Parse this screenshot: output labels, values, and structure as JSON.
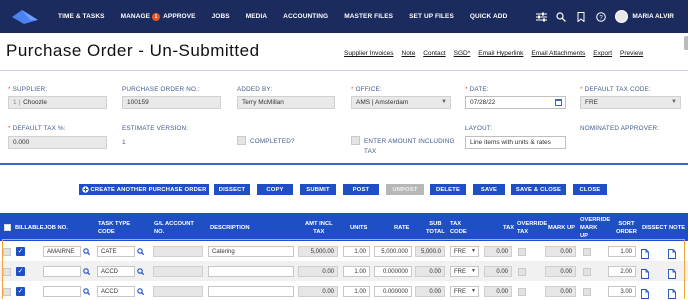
{
  "nav": {
    "items": [
      "TIME & TASKS",
      "MANAGE",
      "APPROVE",
      "JOBS",
      "MEDIA",
      "ACCOUNTING",
      "MASTER FILES",
      "SET UP FILES",
      "QUICK ADD"
    ],
    "approve_badge": "1",
    "user_name": "MARIA ALVIR"
  },
  "page": {
    "title": "Purchase Order - Un-Submitted",
    "action_links": [
      "Supplier Invoices",
      "Note",
      "Contact",
      "SGD*",
      "Email Hyperlink",
      "Email Attachments",
      "Export",
      "Preview"
    ]
  },
  "form": {
    "supplier": {
      "label": "SUPPLIER:",
      "prefix": "1 |",
      "value": "Choozle"
    },
    "po_number": {
      "label": "PURCHASE ORDER NO.:",
      "value": "100159"
    },
    "added_by": {
      "label": "ADDED BY:",
      "value": "Terry McMillan"
    },
    "office": {
      "label": "OFFICE:",
      "value": "AMS | Amsterdam"
    },
    "date": {
      "label": "DATE:",
      "value": "07/28/22"
    },
    "default_tax_code": {
      "label": "DEFAULT TAX CODE:",
      "value": "FRE"
    },
    "default_tax_pct": {
      "label": "DEFAULT TAX %:",
      "value": "0.000"
    },
    "estimate_version": {
      "label": "ESTIMATE VERSION:",
      "value": "1"
    },
    "completed": {
      "label": "COMPLETED?"
    },
    "enter_amount": {
      "label_line1": "ENTER AMOUNT INCLUDING",
      "label_line2": "TAX"
    },
    "layout": {
      "label": "LAYOUT:",
      "value": "Line items with units & rates"
    },
    "nominated_approver": {
      "label": "NOMINATED APPROVER:"
    }
  },
  "buttons": {
    "create_another": "CREATE ANOTHER PURCHASE ORDER",
    "dissect": "DISSECT",
    "copy": "COPY",
    "submit": "SUBMIT",
    "post": "POST",
    "unpost": "UNPOST",
    "delete": "DELETE",
    "save": "SAVE",
    "save_close": "SAVE & CLOSE",
    "close": "CLOSE"
  },
  "table": {
    "headers": {
      "billable": "BILLABLE",
      "job_no": "JOB NO.",
      "task_type_1": "TASK TYPE",
      "task_type_2": "CODE",
      "gl_1": "G/L ACCOUNT",
      "gl_2": "NO.",
      "description": "DESCRIPTION",
      "amt_1": "AMT INCL",
      "amt_2": "TAX",
      "units": "UNITS",
      "rate": "RATE",
      "sub_1": "SUB",
      "sub_2": "TOTAL",
      "tax_code_1": "TAX",
      "tax_code_2": "CODE",
      "tax": "TAX",
      "override_tax_1": "OVERRIDE",
      "override_tax_2": "TAX",
      "mark_up": "MARK UP",
      "override_mu_1": "OVERRIDE",
      "override_mu_2": "MARK",
      "override_mu_3": "UP",
      "sort_1": "SORT",
      "sort_2": "ORDER",
      "dissect": "DISSECT",
      "note": "NOTE"
    },
    "rows": [
      {
        "job": "AMAIRNE",
        "task": "CATE",
        "gl": "",
        "description": "Catering",
        "amt": "5,000.00",
        "units": "1.00",
        "rate": "5,000.000",
        "subtotal": "5,000.0",
        "tax_code": "FRE",
        "tax": "0.00",
        "markup": "0.00",
        "sort": "1.00"
      },
      {
        "job": "",
        "task": "ACCD",
        "gl": "",
        "description": "",
        "amt": "0.00",
        "units": "1.00",
        "rate": "0.000000",
        "subtotal": "0.00",
        "tax_code": "FRE",
        "tax": "0.00",
        "markup": "0.00",
        "sort": "2.00"
      },
      {
        "job": "",
        "task": "ACCD",
        "gl": "",
        "description": "",
        "amt": "0.00",
        "units": "1.00",
        "rate": "0.000000",
        "subtotal": "0.00",
        "tax_code": "FRE",
        "tax": "0.00",
        "markup": "0.00",
        "sort": "3.00"
      }
    ]
  },
  "colors": {
    "nav_bg": "#1c2b5e",
    "accent_blue": "#1e4fc5",
    "label_blue": "#3f5a8a",
    "badge_orange": "#e8541e",
    "selection_orange": "#f0a53b"
  }
}
